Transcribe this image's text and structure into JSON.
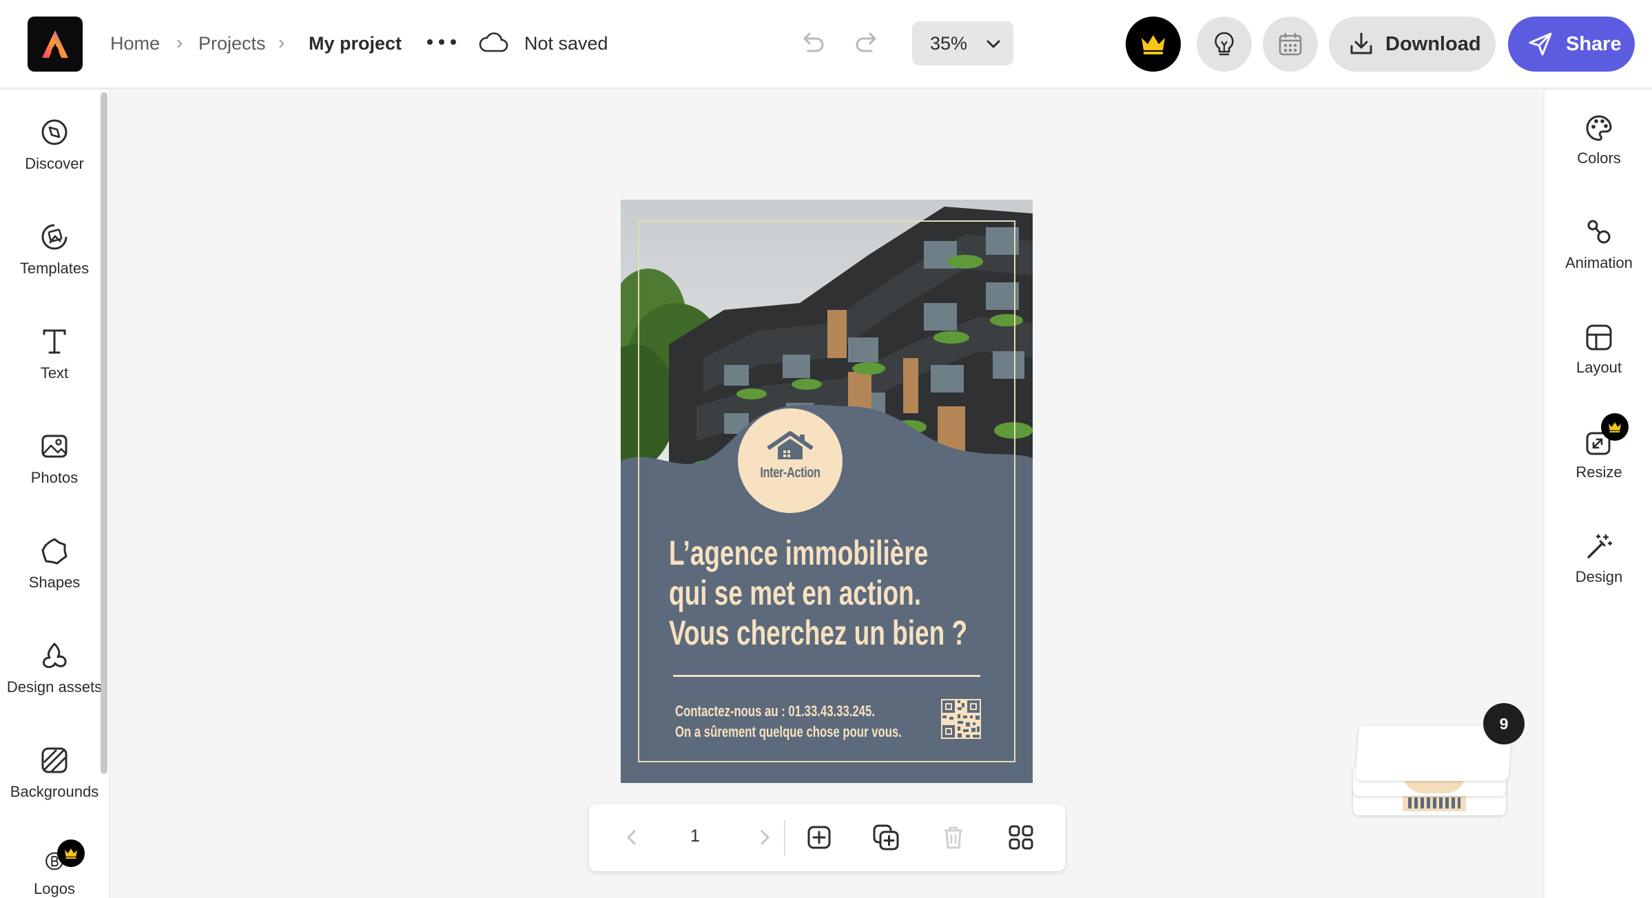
{
  "header": {
    "breadcrumb": [
      "Home",
      "Projects",
      "My project"
    ],
    "save_status": "Not saved",
    "zoom": "35%",
    "download_label": "Download",
    "share_label": "Share"
  },
  "left_rail": {
    "items": [
      {
        "label": "Discover",
        "icon": "compass-icon"
      },
      {
        "label": "Templates",
        "icon": "templates-icon"
      },
      {
        "label": "Text",
        "icon": "text-icon"
      },
      {
        "label": "Photos",
        "icon": "photo-icon"
      },
      {
        "label": "Shapes",
        "icon": "shapes-icon"
      },
      {
        "label": "Design assets",
        "icon": "design-assets-icon"
      },
      {
        "label": "Backgrounds",
        "icon": "backgrounds-icon"
      },
      {
        "label": "Logos",
        "icon": "logos-icon"
      }
    ]
  },
  "right_rail": {
    "items": [
      {
        "label": "Colors",
        "icon": "palette-icon"
      },
      {
        "label": "Animation",
        "icon": "animation-icon"
      },
      {
        "label": "Layout",
        "icon": "layout-icon"
      },
      {
        "label": "Resize",
        "icon": "resize-icon"
      },
      {
        "label": "Design",
        "icon": "magic-wand-icon"
      }
    ]
  },
  "flyer": {
    "logo_text": "Inter-Action",
    "headline": [
      "L’agence immobilière",
      "qui se met en action.",
      "Vous cherchez un bien ?"
    ],
    "contact": [
      "Contactez-nous au : 01.33.43.33.245.",
      "On a sûrement quelque chose pour vous."
    ]
  },
  "page_nav": {
    "current_page": "1"
  },
  "thumbnails": {
    "page_count": "9"
  },
  "colors": {
    "accent": "#5c5ce0",
    "flyer_background": "#5c6a7b",
    "flyer_text": "#f7e1c0",
    "premium_crown": "#f5c518"
  }
}
